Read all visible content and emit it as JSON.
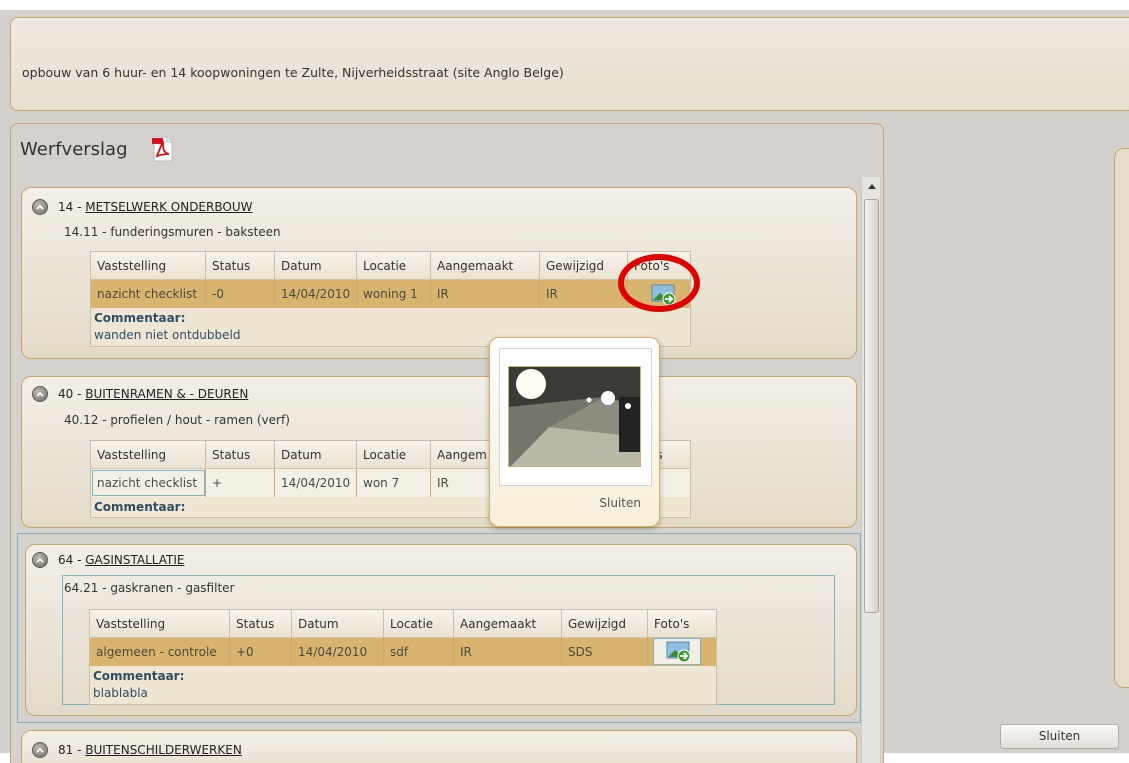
{
  "project": {
    "title": "opbouw van 6 huur- en 14 koopwoningen te Zulte, Nijverheidsstraat (site Anglo Belge)"
  },
  "werfverslag": {
    "title": "Werfverslag",
    "pdf_icon": "pdf-icon",
    "sections": [
      {
        "code": "14",
        "sep": " - ",
        "name": "METSELWERK ONDERBOUW",
        "subtitle": "14.11 - funderingsmuren - baksteen",
        "columns": [
          "Vaststelling",
          "Status",
          "Datum",
          "Locatie",
          "Aangemaakt",
          "Gewijzigd",
          "Foto's"
        ],
        "row": {
          "vaststelling": "nazicht checklist",
          "status": "-0",
          "datum": "14/04/2010",
          "locatie": "woning 1",
          "aangemaakt": "IR",
          "gewijzigd": "IR"
        },
        "comment_label": "Commentaar:",
        "comment": "wanden niet ontdubbeld"
      },
      {
        "code": "40",
        "sep": " - ",
        "name": "BUITENRAMEN & - DEUREN",
        "subtitle": "40.12 - profielen / hout - ramen (verf)",
        "columns": [
          "Vaststelling",
          "Status",
          "Datum",
          "Locatie",
          "Aangem",
          "'s"
        ],
        "row": {
          "vaststelling": "nazicht checklist",
          "status": "+",
          "datum": "14/04/2010",
          "locatie": "won 7",
          "aangemaakt": "IR"
        },
        "comment_label": "Commentaar:"
      },
      {
        "code": "64",
        "sep": " - ",
        "name": "GASINSTALLATIE",
        "subtitle": "64.21 - gaskranen - gasfilter",
        "columns": [
          "Vaststelling",
          "Status",
          "Datum",
          "Locatie",
          "Aangemaakt",
          "Gewijzigd",
          "Foto's"
        ],
        "row": {
          "vaststelling": "algemeen - controle",
          "status": "+0",
          "datum": "14/04/2010",
          "locatie": "sdf",
          "aangemaakt": "IR",
          "gewijzigd": "SDS"
        },
        "comment_label": "Commentaar:",
        "comment": "blablabla"
      },
      {
        "code": "81",
        "sep": " - ",
        "name": "BUITENSCHILDERWERKEN"
      }
    ]
  },
  "photo_popup": {
    "close_label": "Sluiten"
  },
  "footer": {
    "close_label": "Sluiten"
  },
  "colors": {
    "accent_border": "#c8a66a",
    "row_highlight": "#d9b46f",
    "highlight_circle": "#e00000"
  }
}
